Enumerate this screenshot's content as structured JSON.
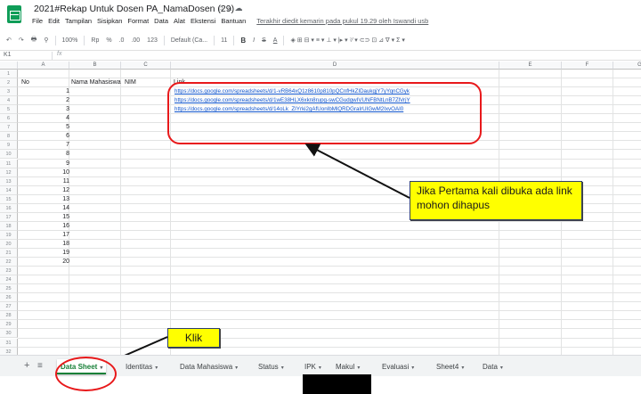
{
  "title": "2021#Rekap Untuk Dosen PA_NamaDosen (29)",
  "title_icons": [
    "star-icon",
    "folder-icon",
    "cloud-icon"
  ],
  "menu": [
    "File",
    "Edit",
    "Tampilan",
    "Sisipkan",
    "Format",
    "Data",
    "Alat",
    "Ekstensi",
    "Bantuan"
  ],
  "last_edit": "Terakhir diedit kemarin pada pukul 19.29 oleh Iswandi usb",
  "toolbar": {
    "undo": "↶",
    "redo": "↷",
    "print": "🖶",
    "paint": "⚲",
    "zoom": "100%",
    "currency": "Rp",
    "percent": "%",
    "dec_less": ".0",
    "dec_more": ".00",
    "format": "123",
    "font": "Default (Ca...",
    "font_size": "11",
    "bold": "B",
    "italic": "I",
    "strike": "S",
    "color": "A",
    "misc": "◈ ⊞ ⊟ ▾  ≡ ▾  ⊥ ▾  |▸ ▾  ⁷⁄ ▾  ⊂⊃  ⊡  ⊿  ∇ ▾  Σ ▾"
  },
  "formula_bar": {
    "cell_ref": "K1",
    "fx": "fx"
  },
  "columns": [
    "A",
    "B",
    "C",
    "D",
    "E",
    "F",
    "G"
  ],
  "rows": [
    "1",
    "2",
    "3",
    "4",
    "5",
    "6",
    "7",
    "8",
    "9",
    "10",
    "11",
    "12",
    "13",
    "14",
    "15",
    "16",
    "17",
    "18",
    "19",
    "20",
    "21",
    "22",
    "23",
    "24",
    "25",
    "26",
    "27",
    "28",
    "29",
    "30",
    "31",
    "32"
  ],
  "headers": {
    "no": "No",
    "nama": "Nama Mahasiswa",
    "nim": "NIM",
    "link": "Link"
  },
  "numbers": [
    "1",
    "2",
    "3",
    "4",
    "5",
    "6",
    "7",
    "8",
    "9",
    "10",
    "11",
    "12",
    "13",
    "14",
    "15",
    "16",
    "17",
    "18",
    "19",
    "20"
  ],
  "links": [
    "https://docs.google.com/spreadsheets/d/1-vRB64xQ1z8610p810pQCnfHkZIDaukgjY7yYqnCGyk",
    "https://docs.google.com/spreadsheets/d/1wE38HLX6xkn8rupg-swCGudgwIVUNFBNtLnB7ZlVrjY",
    "https://docs.google.com/spreadsheets/d/14oLk_ZIYrki2gAfUonIbMlQRDGraIrUIGwM2IxvOAI0"
  ],
  "callout_main": "Jika Pertama kali dibuka ada link mohon dihapus",
  "callout_klik": "Klik",
  "tabs": [
    "Data Sheet",
    "Identitas",
    "Data Mahasiswa",
    "Status",
    "IPK",
    "Makul",
    "Evaluasi",
    "Sheet4",
    "Data"
  ],
  "active_tab": "Data Sheet",
  "colors": {
    "sheets_green": "#0f9d58",
    "annotation_red": "#e8191b",
    "callout_yellow": "#ffff00",
    "link_blue": "#1155cc"
  }
}
